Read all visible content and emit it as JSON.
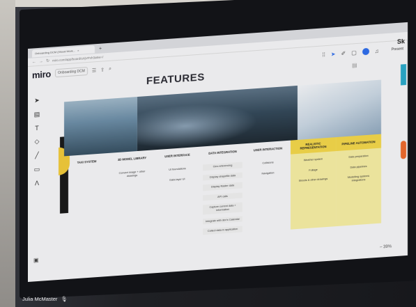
{
  "browser": {
    "tab_title": "Onboarding DCM (Visual Work...",
    "tab_close": "×",
    "new_tab": "+",
    "url": "miro.com/app/board/uXjVPxh3a6w=/",
    "nav_back": "←",
    "nav_forward": "→",
    "nav_reload": "↻"
  },
  "app": {
    "logo": "miro",
    "board_name": "Onboarding DCM",
    "present_label": "Present",
    "right_partial": "Sk"
  },
  "board": {
    "title": "FEATURES",
    "columns": [
      {
        "header": "TAXI SYSTEM",
        "items": [],
        "style": "plain"
      },
      {
        "header": "3D MODEL LIBRARY",
        "items": [
          "Convert image + other drawings"
        ],
        "style": "plain"
      },
      {
        "header": "USER INTERFACE",
        "items": [
          "UI foundations",
          "Data layer UI"
        ],
        "style": "plain"
      },
      {
        "header": "DATA INTEGRATION",
        "items": [
          "Geo-referencing",
          "Display shapefile data",
          "Display Raster data",
          "API calls",
          "Capture current data + information",
          "Integrate with dev's Calendar",
          "Collect data in application"
        ],
        "style": "grey"
      },
      {
        "header": "USER INTERACTION",
        "items": [
          "Collisions",
          "Navigation"
        ],
        "style": "plain"
      },
      {
        "header": "REALISTIC REPRESENTATION",
        "items": [
          "Weather system",
          "Foliage",
          "Streets & other drawings"
        ],
        "style": "yellow"
      },
      {
        "header": "PIPELINE AUTOMATION",
        "items": [
          "Data preparation",
          "Data pipelines",
          "Modelling systems integrations"
        ],
        "style": "yellow"
      }
    ]
  },
  "zoom": {
    "minus": "–",
    "value": "39%"
  },
  "presenter": {
    "name": "Julia McMaster",
    "mic_icon": "mic-icon"
  },
  "colors": {
    "highlight_yellow": "#f2d64a",
    "light_yellow": "#f5eca2",
    "accent_blue": "#2f6dea"
  }
}
